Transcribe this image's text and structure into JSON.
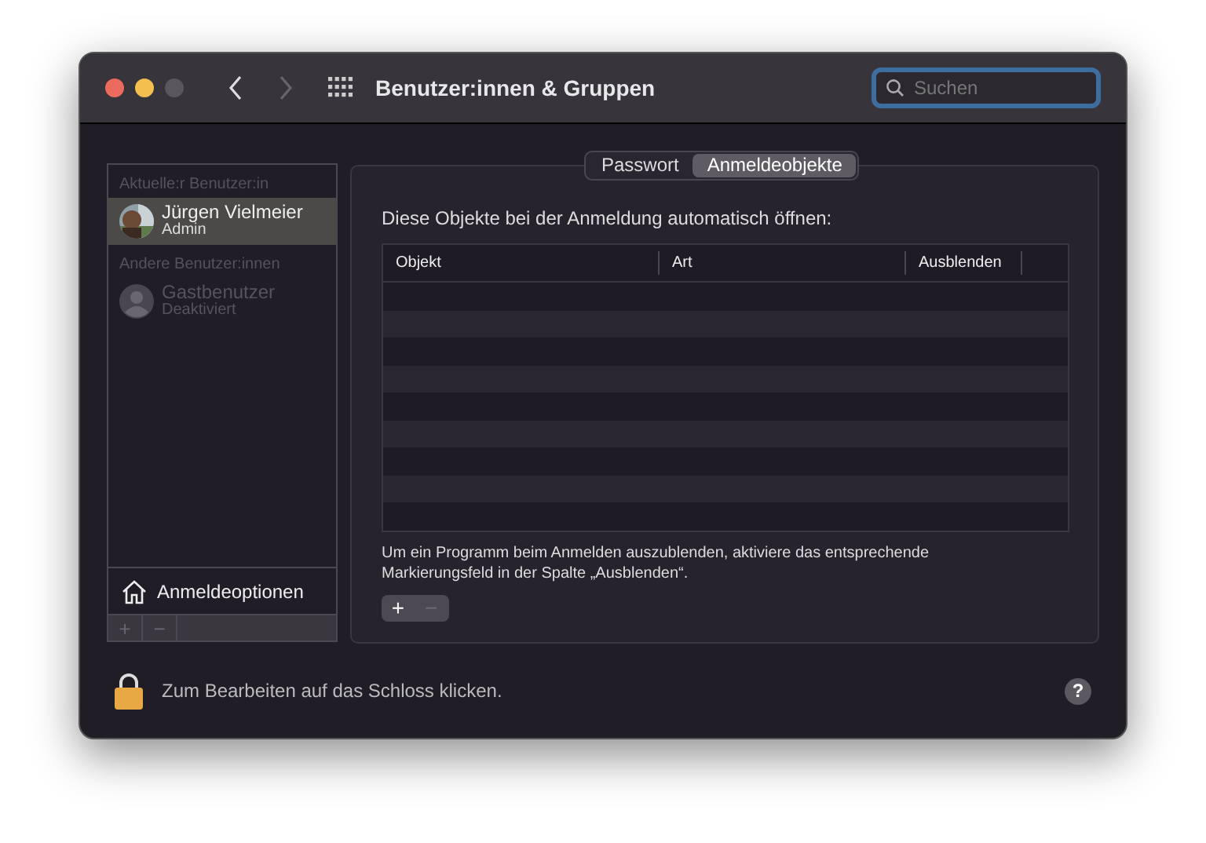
{
  "window": {
    "title": "Benutzer:innen & Gruppen"
  },
  "search": {
    "placeholder": "Suchen",
    "focused": true
  },
  "sidebar": {
    "sections": [
      {
        "heading": "Aktuelle:r Benutzer:in",
        "users": [
          {
            "name": "Jürgen Vielmeier",
            "role": "Admin",
            "selected": true,
            "disabled": false
          }
        ]
      },
      {
        "heading": "Andere Benutzer:innen",
        "users": [
          {
            "name": "Gastbenutzer",
            "role": "Deaktiviert",
            "selected": false,
            "disabled": true,
            "kind": "guest"
          }
        ]
      }
    ],
    "login_options": "Anmeldeoptionen",
    "buttons": [
      {
        "label": "+",
        "disabled": true
      },
      {
        "label": "−",
        "disabled": true
      }
    ]
  },
  "tabs": [
    {
      "label": "Passwort",
      "selected": false
    },
    {
      "label": "Anmeldeobjekte",
      "selected": true
    }
  ],
  "heading": "Diese Objekte bei der Anmeldung automatisch öffnen:",
  "table": {
    "columns": [
      "Objekt",
      "Art",
      "Ausblenden"
    ]
  },
  "hint": "Um ein Programm beim Anmelden auszublenden, aktiviere das entsprechende Markierungsfeld in der Spalte „Ausblenden“.",
  "buttons": [
    {
      "label": "+",
      "disabled": false
    },
    {
      "label": "−",
      "disabled": true
    }
  ],
  "footer": {
    "text": "Zum Bearbeiten auf das Schloss klicken.",
    "help": "?"
  }
}
